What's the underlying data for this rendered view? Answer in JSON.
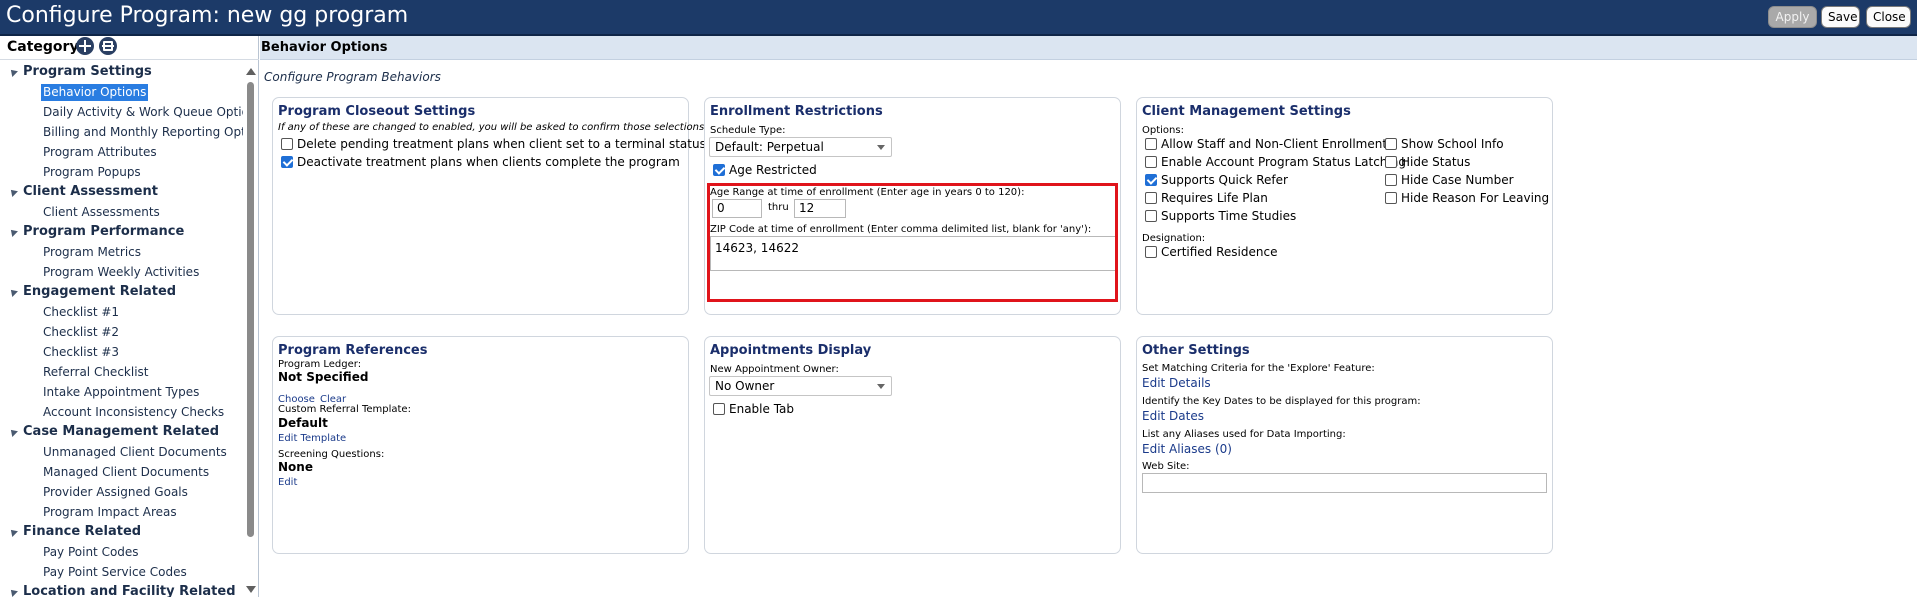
{
  "window": {
    "title": "Configure Program: new gg program",
    "buttons": {
      "apply": "Apply",
      "save": "Save",
      "close": "Close"
    }
  },
  "sidebar": {
    "header": "Category",
    "groups": [
      {
        "label": "Program Settings",
        "items": [
          "Behavior Options",
          "Daily Activity & Work Queue Options",
          "Billing and Monthly Reporting Option",
          "Program Attributes",
          "Program Popups"
        ]
      },
      {
        "label": "Client Assessment",
        "items": [
          "Client Assessments"
        ]
      },
      {
        "label": "Program Performance",
        "items": [
          "Program Metrics",
          "Program Weekly Activities"
        ]
      },
      {
        "label": "Engagement Related",
        "items": [
          "Checklist #1",
          "Checklist #2",
          "Checklist #3",
          "Referral Checklist",
          "Intake Appointment Types",
          "Account Inconsistency Checks"
        ]
      },
      {
        "label": "Case Management Related",
        "items": [
          "Unmanaged Client Documents",
          "Managed Client Documents",
          "Provider Assigned Goals",
          "Program Impact Areas"
        ]
      },
      {
        "label": "Finance Related",
        "items": [
          "Pay Point Codes",
          "Pay Point Service Codes"
        ]
      },
      {
        "label": "Location and Facility Related",
        "items": []
      }
    ],
    "selected": "Behavior Options"
  },
  "main": {
    "title": "Behavior Options",
    "subtitle": "Configure Program Behaviors"
  },
  "closeout": {
    "title": "Program Closeout Settings",
    "note": "If any of these are changed to enabled, you will be asked to confirm those selections",
    "options": [
      {
        "label": "Delete pending treatment plans when client set to a terminal status",
        "checked": false
      },
      {
        "label": "Deactivate treatment plans when clients complete the program",
        "checked": true
      }
    ]
  },
  "enrollment": {
    "title": "Enrollment Restrictions",
    "schedule_label": "Schedule Type:",
    "schedule_value": "Default: Perpetual",
    "age_restricted_label": "Age Restricted",
    "age_restricted": true,
    "age_range_label": "Age Range at time of enrollment (Enter age in years 0 to 120):",
    "age_from": "0",
    "thru_label": "thru",
    "age_to": "12",
    "zip_label": "ZIP Code at time of enrollment (Enter comma delimited list, blank for 'any'):",
    "zip_value": "14623, 14622"
  },
  "client_mgmt": {
    "title": "Client Management Settings",
    "options_label": "Options:",
    "left_options": [
      {
        "label": "Allow Staff and Non-Client Enrollment",
        "checked": false
      },
      {
        "label": "Enable Account Program Status Latching",
        "checked": false
      },
      {
        "label": "Supports Quick Refer",
        "checked": true
      },
      {
        "label": "Requires Life Plan",
        "checked": false
      },
      {
        "label": "Supports Time Studies",
        "checked": false
      }
    ],
    "right_options": [
      {
        "label": "Show School Info",
        "checked": false
      },
      {
        "label": "Hide Status",
        "checked": false
      },
      {
        "label": "Hide Case Number",
        "checked": false
      },
      {
        "label": "Hide Reason For Leaving",
        "checked": false
      }
    ],
    "designation_label": "Designation:",
    "designation_option": {
      "label": "Certified Residence",
      "checked": false
    }
  },
  "references": {
    "title": "Program References",
    "ledger_label": "Program Ledger:",
    "ledger_value": "Not Specified",
    "choose_link": "Choose",
    "clear_link": "Clear",
    "referral_label": "Custom Referral Template:",
    "referral_value": "Default",
    "edit_template_link": "Edit Template",
    "screening_label": "Screening Questions:",
    "screening_value": "None",
    "edit_link": "Edit"
  },
  "appointments": {
    "title": "Appointments Display",
    "owner_label": "New Appointment Owner:",
    "owner_value": "No Owner",
    "enable_tab_label": "Enable Tab",
    "enable_tab": false
  },
  "other": {
    "title": "Other Settings",
    "matching_label": "Set Matching Criteria for the 'Explore' Feature:",
    "matching_link": "Edit Details",
    "dates_label": "Identify the Key Dates to be displayed for this program:",
    "dates_link": "Edit Dates",
    "aliases_label": "List any Aliases used for Data Importing:",
    "aliases_link": "Edit Aliases (0)",
    "website_label": "Web Site:",
    "website_value": ""
  }
}
